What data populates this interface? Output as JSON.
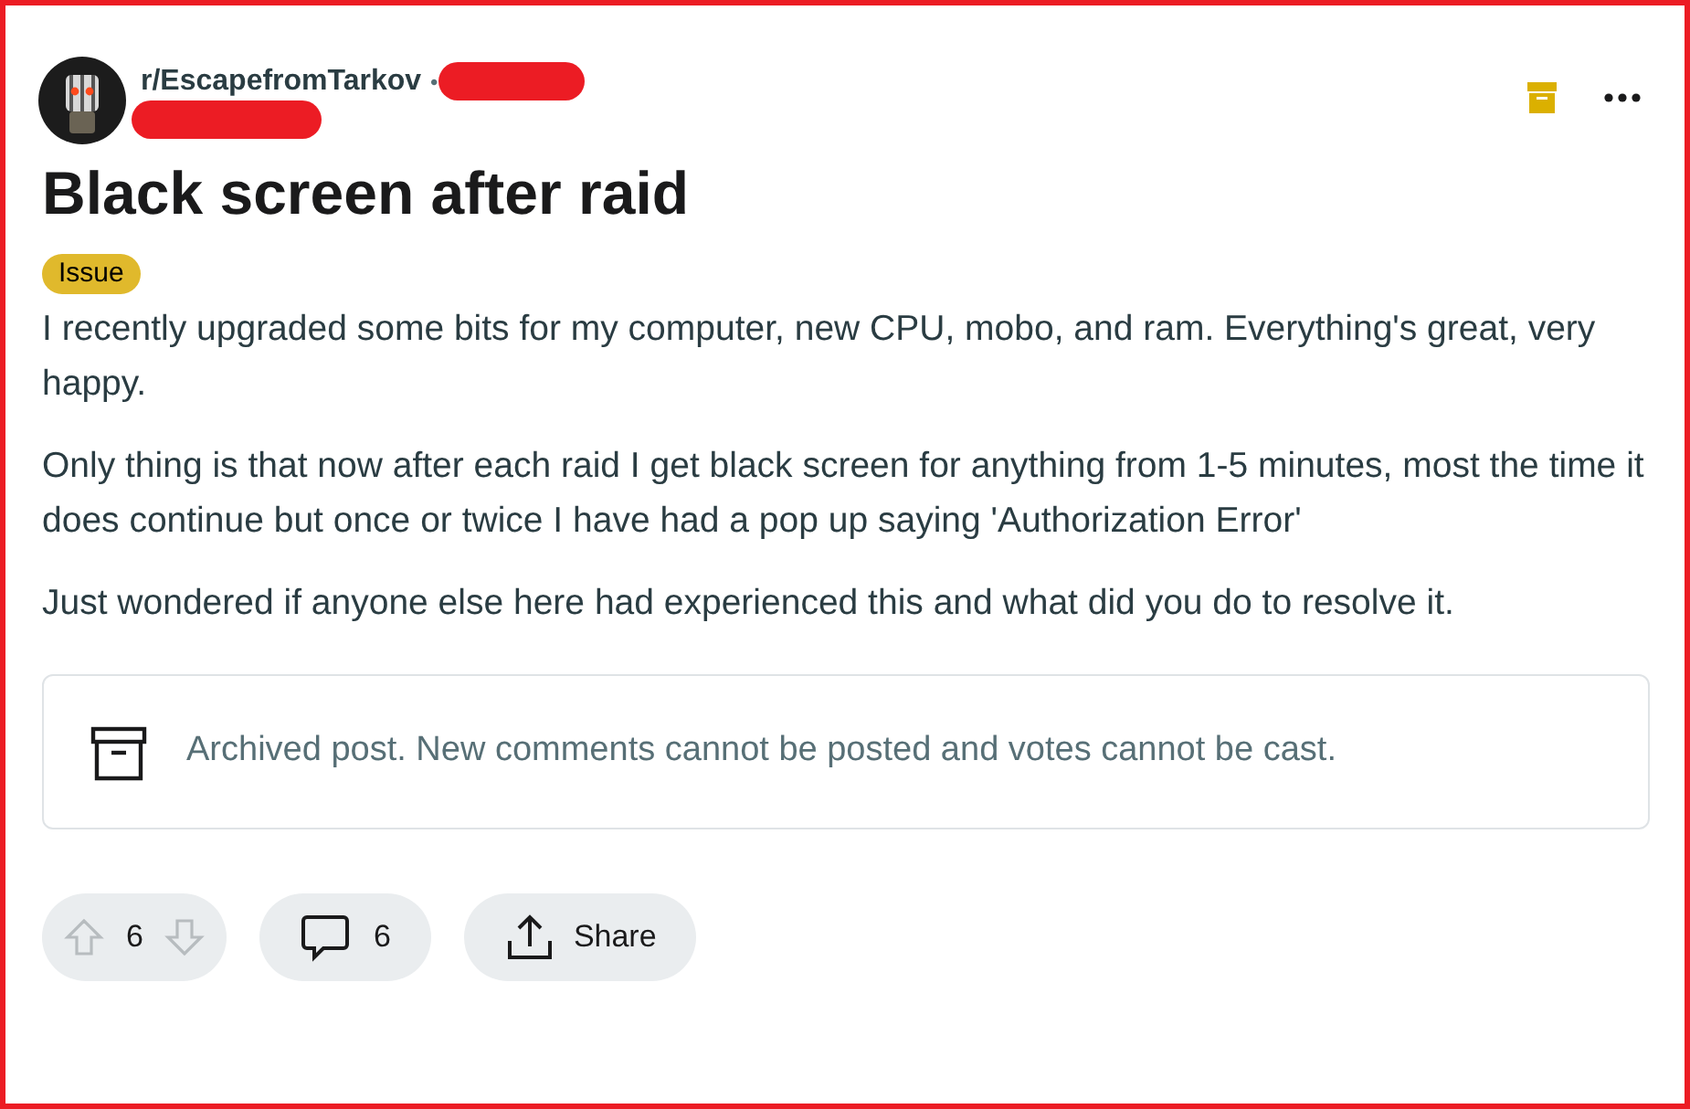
{
  "post": {
    "subreddit": "r/EscapefromTarkov",
    "separator": "•",
    "archived": true,
    "title": "Black screen after raid",
    "flair": {
      "label": "Issue",
      "color": "#e0b92c"
    },
    "paragraphs": [
      "I recently upgraded some bits for my computer, new CPU, mobo, and ram. Everything's great, very happy.",
      "Only thing is that now after each raid I get black screen for anything from 1-5 minutes, most the time it does continue but once or twice I have had a pop up saying 'Authorization Error'",
      "Just wondered if anyone else here had experienced this and what did you do to resolve it."
    ],
    "notice": "Archived post. New comments cannot be posted and votes cannot be cast.",
    "votes": {
      "count": "6",
      "disabled": true
    },
    "comments": {
      "count": "6"
    },
    "share": {
      "label": "Share"
    }
  }
}
